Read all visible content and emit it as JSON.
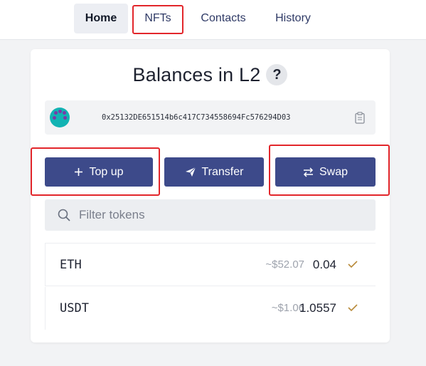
{
  "nav": {
    "tabs": [
      {
        "label": "Home",
        "active": true
      },
      {
        "label": "NFTs",
        "active": false
      },
      {
        "label": "Contacts",
        "active": false
      },
      {
        "label": "History",
        "active": false
      }
    ]
  },
  "card": {
    "title": "Balances in L2",
    "help_label": "?",
    "address": "0x25132DE651514b6c417C734558694Fc576294D03",
    "actions": {
      "topup_label": "Top up",
      "transfer_label": "Transfer",
      "swap_label": "Swap"
    },
    "filter": {
      "placeholder": "Filter tokens"
    },
    "tokens": [
      {
        "symbol": "ETH",
        "usd": "~$52.07",
        "amount": "0.04"
      },
      {
        "symbol": "USDT",
        "usd": "~$1.06",
        "amount": "1.0557"
      }
    ]
  },
  "colors": {
    "accent": "#3d4a8a",
    "highlight": "#e2262b",
    "check": "#b88a3a",
    "avatar": "#12b3b3"
  },
  "icons": [
    "help-icon",
    "avatar",
    "clipboard-icon",
    "plus-icon",
    "send-icon",
    "swap-icon",
    "search-icon",
    "check-icon"
  ]
}
